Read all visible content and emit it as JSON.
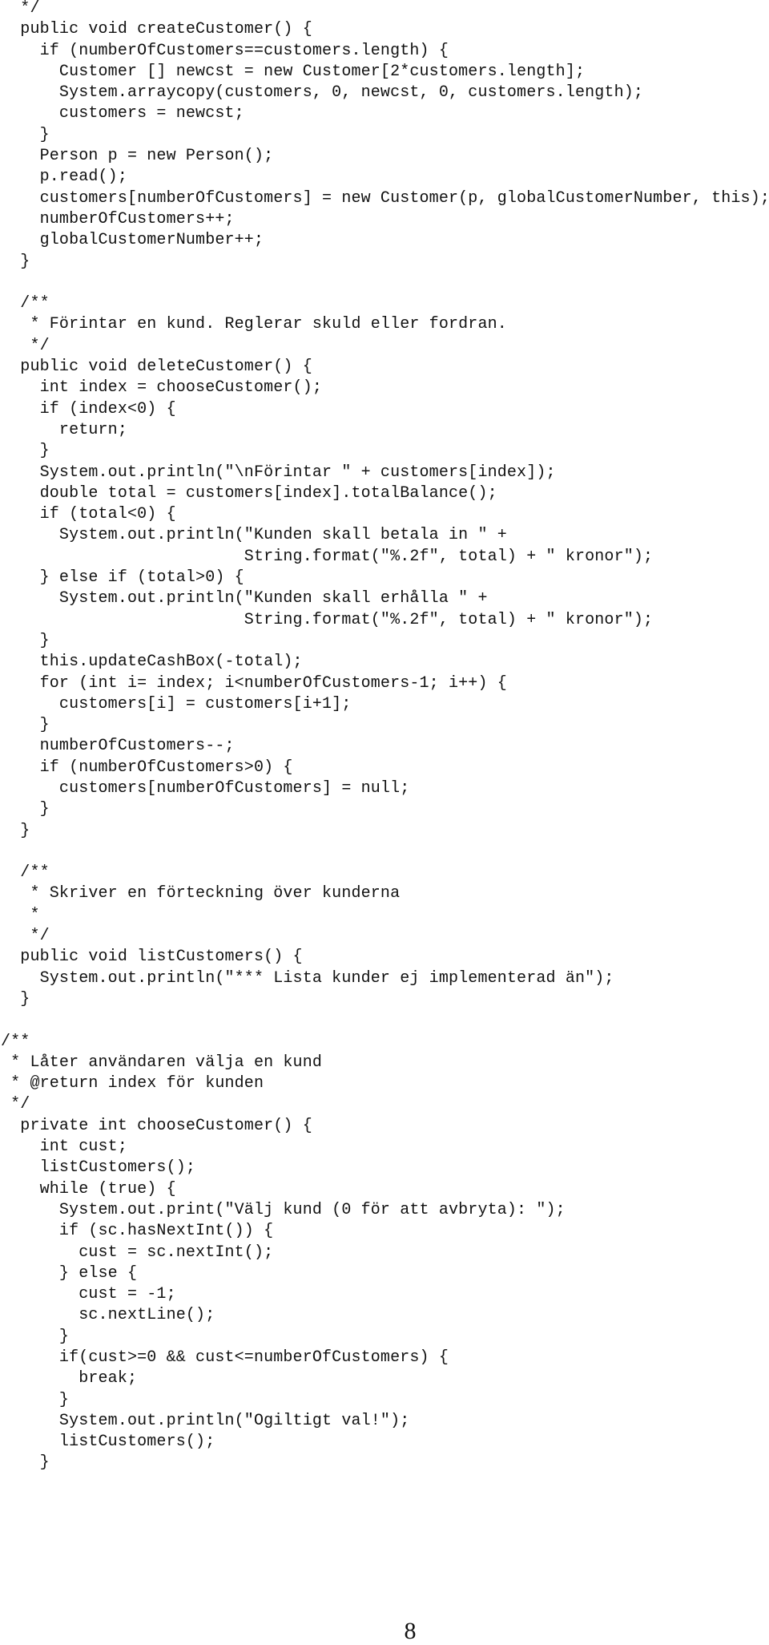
{
  "document": {
    "type": "java-source-listing",
    "page_number": "8",
    "lines": [
      "  */",
      "  public void createCustomer() {",
      "    if (numberOfCustomers==customers.length) {",
      "      Customer [] newcst = new Customer[2*customers.length];",
      "      System.arraycopy(customers, 0, newcst, 0, customers.length);",
      "      customers = newcst;",
      "    }",
      "    Person p = new Person();",
      "    p.read();",
      "    customers[numberOfCustomers] = new Customer(p, globalCustomerNumber, this);",
      "    numberOfCustomers++;",
      "    globalCustomerNumber++;",
      "  }",
      "",
      "  /**",
      "   * Förintar en kund. Reglerar skuld eller fordran.",
      "   */",
      "  public void deleteCustomer() {",
      "    int index = chooseCustomer();",
      "    if (index<0) {",
      "      return;",
      "    }",
      "    System.out.println(\"\\nFörintar \" + customers[index]);",
      "    double total = customers[index].totalBalance();",
      "    if (total<0) {",
      "      System.out.println(\"Kunden skall betala in \" +",
      "                         String.format(\"%.2f\", total) + \" kronor\");",
      "    } else if (total>0) {",
      "      System.out.println(\"Kunden skall erhålla \" +",
      "                         String.format(\"%.2f\", total) + \" kronor\");",
      "    }",
      "    this.updateCashBox(-total);",
      "    for (int i= index; i<numberOfCustomers-1; i++) {",
      "      customers[i] = customers[i+1];",
      "    }",
      "    numberOfCustomers--;",
      "    if (numberOfCustomers>0) {",
      "      customers[numberOfCustomers] = null;",
      "    }",
      "  }",
      "",
      "  /**",
      "   * Skriver en förteckning över kunderna",
      "   *",
      "   */",
      "  public void listCustomers() {",
      "    System.out.println(\"*** Lista kunder ej implementerad än\");",
      "  }",
      "",
      "/**",
      " * Låter användaren välja en kund",
      " * @return index för kunden",
      " */",
      "  private int chooseCustomer() {",
      "    int cust;",
      "    listCustomers();",
      "    while (true) {",
      "      System.out.print(\"Välj kund (0 för att avbryta): \");",
      "      if (sc.hasNextInt()) {",
      "        cust = sc.nextInt();",
      "      } else {",
      "        cust = -1;",
      "        sc.nextLine();",
      "      }",
      "      if(cust>=0 && cust<=numberOfCustomers) {",
      "        break;",
      "      }",
      "      System.out.println(\"Ogiltigt val!\");",
      "      listCustomers();",
      "    }"
    ]
  }
}
